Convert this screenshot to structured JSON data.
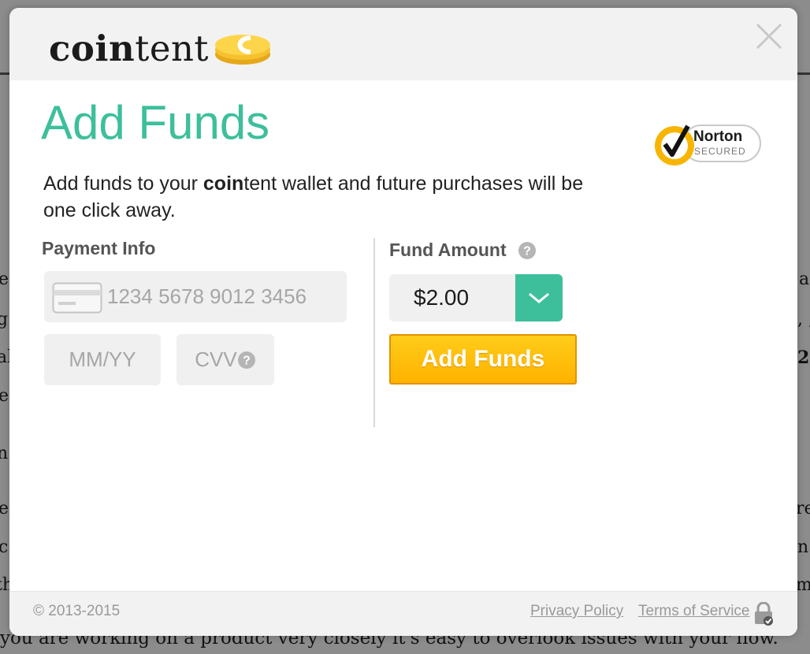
{
  "background": {
    "left_fragments": [
      "e",
      "g",
      "al",
      "e",
      "n",
      "e,",
      "c",
      "th"
    ],
    "right_fragments": [
      "a",
      ", ;",
      "2",
      "re",
      "n",
      "m"
    ],
    "bottom_line": "you are working on a product very closely it's easy to overlook issues with your flow."
  },
  "header": {
    "logo_bold": "coin",
    "logo_rest": "tent",
    "close_icon": "close-icon"
  },
  "main": {
    "title": "Add Funds",
    "badge": {
      "name": "Norton",
      "sub": "SECURED",
      "icon": "checkmark-icon"
    },
    "description": {
      "before": "Add funds to your ",
      "brand_bold": "coin",
      "brand_rest": "tent",
      "after": " wallet and future purchases will be one click away."
    }
  },
  "payment": {
    "label": "Payment Info",
    "card_icon": "credit-card-icon",
    "card_placeholder": "1234 5678 9012 3456",
    "expiry_placeholder": "MM/YY",
    "cvv_placeholder": "CVV",
    "cvv_help_icon": "question-icon"
  },
  "fund": {
    "label": "Fund Amount",
    "help_icon": "question-icon",
    "amount": "$2.00",
    "toggle_icon": "chevron-down-icon",
    "button": "Add Funds"
  },
  "footer": {
    "copyright": "© 2013-2015",
    "privacy": "Privacy Policy",
    "terms": "Terms of Service",
    "lock_icon": "lock-icon"
  },
  "colors": {
    "accent": "#3dbf9b",
    "button": "#ffb300",
    "coin": "#f7c12e"
  }
}
